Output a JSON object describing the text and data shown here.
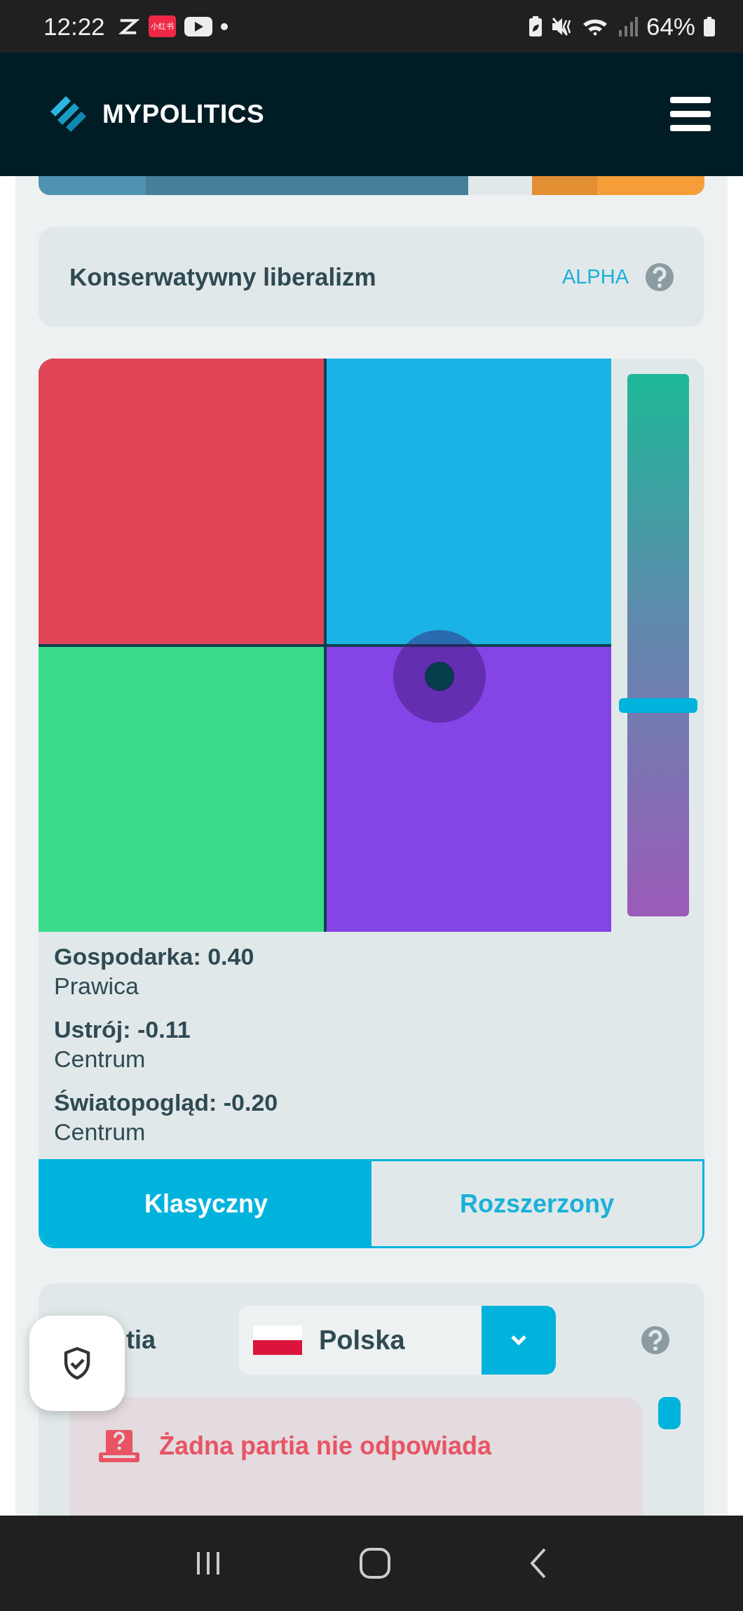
{
  "status_bar": {
    "time": "12:22",
    "app_badge": "小红书",
    "battery": "64%"
  },
  "header": {
    "brand": "MYPOLITICS"
  },
  "score_bar": {
    "segments": [
      {
        "color": "#4e93b0"
      },
      {
        "color": "#45809b"
      },
      {
        "color": "#e1e8ea"
      },
      {
        "color": "#e28e33"
      },
      {
        "color": "#f59d38"
      }
    ]
  },
  "ideology": {
    "title": "Konserwatywny liberalizm",
    "badge": "ALPHA"
  },
  "compass": {
    "quadrants": [
      {
        "color": "#e04555"
      },
      {
        "color": "#1bb3e6"
      },
      {
        "color": "#39dc8a"
      },
      {
        "color": "#8544e6"
      }
    ],
    "slider": {
      "level": 0.39
    },
    "axes": [
      {
        "name": "Gospodarka:",
        "value": "0.40",
        "position": "Prawica"
      },
      {
        "name": "Ustrój:",
        "value": "-0.11",
        "position": "Centrum"
      },
      {
        "name": "Światopogląd:",
        "value": "-0.20",
        "position": "Centrum"
      }
    ]
  },
  "view_tabs": [
    {
      "label": "Klasyczny",
      "selected": true
    },
    {
      "label": "Rozszerzony",
      "selected": false
    }
  ],
  "party": {
    "label": "tia",
    "country": "Polska",
    "alert": "Żadna partia nie odpowiada"
  }
}
